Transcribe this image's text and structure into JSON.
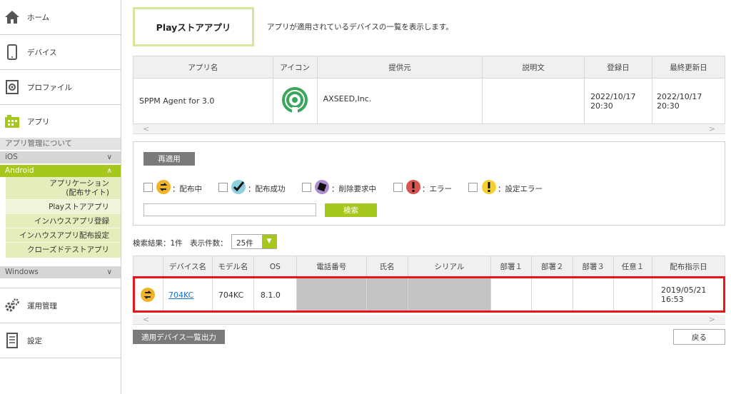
{
  "sidebar": {
    "items": [
      {
        "label": "ホーム",
        "icon": "home-icon"
      },
      {
        "label": "デバイス",
        "icon": "device-icon"
      },
      {
        "label": "プロファイル",
        "icon": "profile-icon"
      },
      {
        "label": "アプリ",
        "icon": "app-icon"
      }
    ],
    "app_sections": {
      "about": "アプリ管理について",
      "ios": "iOS",
      "android": "Android",
      "windows": "Windows"
    },
    "android_sub": [
      "アプリケーション\n(配布サイト)",
      "Playストアアプリ",
      "インハウスアプリ登録",
      "インハウスアプリ配布設定",
      "クローズドテストアプリ"
    ],
    "bottom": [
      {
        "label": "運用管理",
        "icon": "gears-icon"
      },
      {
        "label": "設定",
        "icon": "settings-doc-icon"
      }
    ]
  },
  "page": {
    "title": "Playストアアプリ",
    "description": "アプリが適用されているデバイスの一覧を表示します。"
  },
  "app_table": {
    "headers": [
      "アプリ名",
      "アイコン",
      "提供元",
      "説明文",
      "登録日",
      "最終更新日"
    ],
    "row": {
      "name": "SPPM Agent for 3.0",
      "provider": "AXSEED,Inc.",
      "description": "",
      "registered_date": "2022/10/17",
      "registered_time": "20:30",
      "updated_date": "2022/10/17",
      "updated_time": "20:30"
    }
  },
  "filter": {
    "reapply": "再適用",
    "statuses": [
      {
        "label": "：配布中",
        "icon": "distributing-icon",
        "color": "#f0b429"
      },
      {
        "label": "：配布成功",
        "icon": "check-icon",
        "color": "#8fd0e0"
      },
      {
        "label": "：削除要求中",
        "icon": "delete-request-icon",
        "color": "#b08fd0"
      },
      {
        "label": "：エラー",
        "icon": "error-icon",
        "color": "#d9534f"
      },
      {
        "label": "：設定エラー",
        "icon": "setting-error-icon",
        "color": "#f5d033"
      }
    ],
    "search_placeholder": "",
    "search_button": "検索"
  },
  "results": {
    "label": "検索結果：1件　表示件数：",
    "page_size": "25件"
  },
  "device_table": {
    "headers": [
      "",
      "デバイス名",
      "モデル名",
      "OS",
      "電話番号",
      "氏名",
      "シリアル",
      "部署１",
      "部署２",
      "部署３",
      "任意１",
      "配布指示日"
    ],
    "row": {
      "status_icon": "distributing-icon",
      "device_name": "704KC",
      "model": "704KC",
      "os": "8.1.0",
      "phone": "",
      "name": "",
      "serial": "",
      "dept1": "",
      "dept2": "",
      "dept3": "",
      "free1": "",
      "date": "2019/05/21",
      "time": "16:53"
    }
  },
  "footer": {
    "export": "適用デバイス一覧出力",
    "back": "戻る"
  },
  "colors": {
    "accent_green": "#a6c81e",
    "highlight_red": "#e8141a",
    "title_border": "#d4e79a"
  }
}
